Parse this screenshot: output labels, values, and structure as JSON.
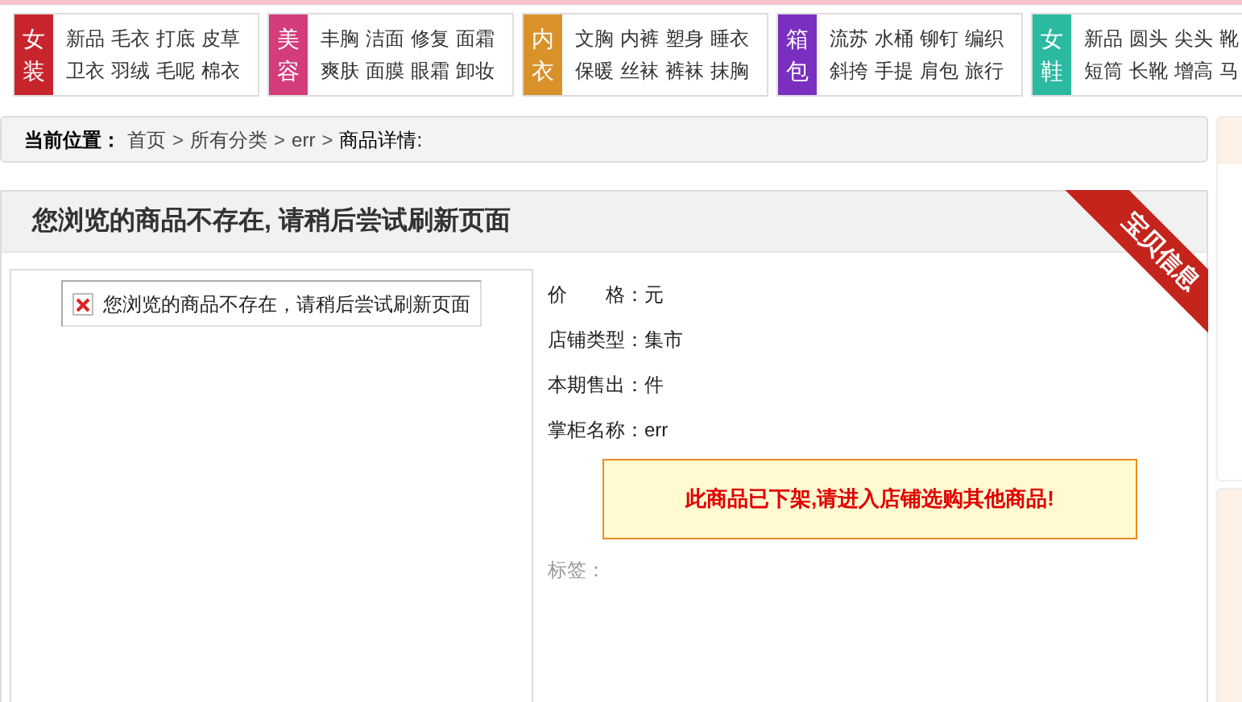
{
  "categories": [
    {
      "label": "女装",
      "color": "#c8242c",
      "rows": [
        [
          "新品",
          "毛衣",
          "打底",
          "皮草"
        ],
        [
          "卫衣",
          "羽绒",
          "毛呢",
          "棉衣"
        ]
      ]
    },
    {
      "label": "美容",
      "color": "#d43c7c",
      "rows": [
        [
          "丰胸",
          "洁面",
          "修复",
          "面霜"
        ],
        [
          "爽肤",
          "面膜",
          "眼霜",
          "卸妆"
        ]
      ]
    },
    {
      "label": "内衣",
      "color": "#d9922a",
      "rows": [
        [
          "文胸",
          "内裤",
          "塑身",
          "睡衣"
        ],
        [
          "保暖",
          "丝袜",
          "裤袜",
          "抹胸"
        ]
      ]
    },
    {
      "label": "箱包",
      "color": "#7a2fc0",
      "rows": [
        [
          "流苏",
          "水桶",
          "铆钉",
          "编织"
        ],
        [
          "斜挎",
          "手提",
          "肩包",
          "旅行"
        ]
      ]
    },
    {
      "label": "女鞋",
      "color": "#2bb9a0",
      "rows": [
        [
          "新品",
          "圆头",
          "尖头",
          "靴"
        ],
        [
          "短筒",
          "长靴",
          "增高",
          "马"
        ]
      ]
    }
  ],
  "breadcrumb": {
    "label": "当前位置：",
    "links": [
      "首页",
      "所有分类",
      "err"
    ],
    "separator": ">",
    "current": "商品详情:"
  },
  "title": "您浏览的商品不存在, 请稍后尝试刷新页面",
  "ribbon": "宝贝信息",
  "image_alt": "您浏览的商品不存在，请稍后尝试刷新页面",
  "details": [
    {
      "label": "价　　格：",
      "value": "元"
    },
    {
      "label": "店铺类型：",
      "value": "集市"
    },
    {
      "label": "本期售出：",
      "value": "件"
    },
    {
      "label": "掌柜名称：",
      "value": "err"
    }
  ],
  "notice": "此商品已下架,请进入店铺选购其他商品!",
  "tags_label": "标签："
}
